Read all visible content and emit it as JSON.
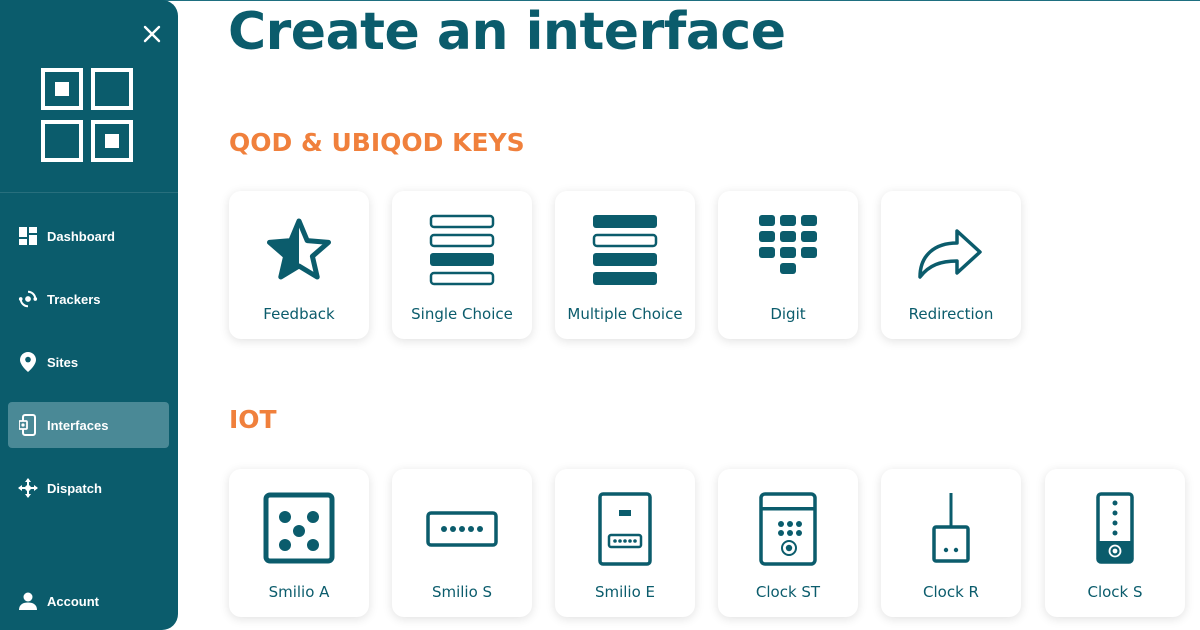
{
  "page": {
    "title": "Create an interface"
  },
  "colors": {
    "primary": "#0b5c6c",
    "accent": "#f0803c",
    "active_nav": "#4a8996"
  },
  "sidebar": {
    "close_icon": "close-icon",
    "logo": "qod-logo",
    "items": [
      {
        "label": "Dashboard",
        "icon": "dashboard-icon",
        "active": false
      },
      {
        "label": "Trackers",
        "icon": "trackers-icon",
        "active": false
      },
      {
        "label": "Sites",
        "icon": "location-pin-icon",
        "active": false
      },
      {
        "label": "Interfaces",
        "icon": "interfaces-icon",
        "active": true
      },
      {
        "label": "Dispatch",
        "icon": "dispatch-icon",
        "active": false
      }
    ],
    "account": {
      "label": "Account",
      "icon": "user-icon"
    }
  },
  "sections": [
    {
      "title": "QOD & UBIQOD KEYS",
      "cards": [
        {
          "label": "Feedback",
          "icon": "star-icon"
        },
        {
          "label": "Single Choice",
          "icon": "single-choice-icon"
        },
        {
          "label": "Multiple Choice",
          "icon": "multiple-choice-icon"
        },
        {
          "label": "Digit",
          "icon": "keypad-icon"
        },
        {
          "label": "Redirection",
          "icon": "share-arrow-icon"
        }
      ]
    },
    {
      "title": "IOT",
      "cards": [
        {
          "label": "Smilio A",
          "icon": "smilio-a-icon"
        },
        {
          "label": "Smilio S",
          "icon": "smilio-s-icon"
        },
        {
          "label": "Smilio E",
          "icon": "smilio-e-icon"
        },
        {
          "label": "Clock ST",
          "icon": "clock-st-icon"
        },
        {
          "label": "Clock R",
          "icon": "clock-r-icon"
        },
        {
          "label": "Clock S",
          "icon": "clock-s-icon"
        }
      ]
    }
  ]
}
